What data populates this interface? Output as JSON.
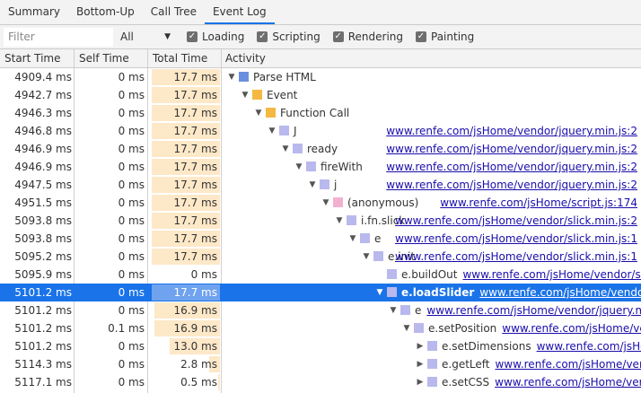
{
  "tabs": [
    "Summary",
    "Bottom-Up",
    "Call Tree",
    "Event Log"
  ],
  "selected_tab": "Event Log",
  "filter": {
    "placeholder": "Filter",
    "value": ""
  },
  "category_select": {
    "value": "All"
  },
  "checkboxes": [
    {
      "label": "Loading",
      "checked": true
    },
    {
      "label": "Scripting",
      "checked": true
    },
    {
      "label": "Rendering",
      "checked": true
    },
    {
      "label": "Painting",
      "checked": true
    }
  ],
  "columns": [
    "Start Time",
    "Self Time",
    "Total Time",
    "Activity"
  ],
  "colors": {
    "parse_html": "#6b8fe0",
    "event": "#f4b942",
    "script": "#b9b9ee",
    "anonymous": "#f3b1d0",
    "selection": "#1a73e8",
    "total_bar": "#fde8c8"
  },
  "rows": [
    {
      "start": "4909.4 ms",
      "self": "0 ms",
      "total": "17.7 ms",
      "total_frac": 1.0,
      "depth": 0,
      "arrow": "down",
      "color": "#6b8fe0",
      "name": "Parse HTML",
      "link": "",
      "link_align": "inline"
    },
    {
      "start": "4942.7 ms",
      "self": "0 ms",
      "total": "17.7 ms",
      "total_frac": 1.0,
      "depth": 1,
      "arrow": "down",
      "color": "#f4b942",
      "name": "Event",
      "link": "",
      "link_align": "inline"
    },
    {
      "start": "4946.3 ms",
      "self": "0 ms",
      "total": "17.7 ms",
      "total_frac": 1.0,
      "depth": 2,
      "arrow": "down",
      "color": "#f4b942",
      "name": "Function Call",
      "link": "",
      "link_align": "inline"
    },
    {
      "start": "4946.8 ms",
      "self": "0 ms",
      "total": "17.7 ms",
      "total_frac": 1.0,
      "depth": 3,
      "arrow": "down",
      "color": "#b9b9ee",
      "name": "J",
      "link": "www.renfe.com/jsHome/vendor/jquery.min.js:2",
      "link_align": "right"
    },
    {
      "start": "4946.9 ms",
      "self": "0 ms",
      "total": "17.7 ms",
      "total_frac": 1.0,
      "depth": 4,
      "arrow": "down",
      "color": "#b9b9ee",
      "name": "ready",
      "link": "www.renfe.com/jsHome/vendor/jquery.min.js:2",
      "link_align": "right"
    },
    {
      "start": "4946.9 ms",
      "self": "0 ms",
      "total": "17.7 ms",
      "total_frac": 1.0,
      "depth": 5,
      "arrow": "down",
      "color": "#b9b9ee",
      "name": "fireWith",
      "link": "www.renfe.com/jsHome/vendor/jquery.min.js:2",
      "link_align": "right"
    },
    {
      "start": "4947.5 ms",
      "self": "0 ms",
      "total": "17.7 ms",
      "total_frac": 1.0,
      "depth": 6,
      "arrow": "down",
      "color": "#b9b9ee",
      "name": "j",
      "link": "www.renfe.com/jsHome/vendor/jquery.min.js:2",
      "link_align": "right"
    },
    {
      "start": "4951.5 ms",
      "self": "0 ms",
      "total": "17.7 ms",
      "total_frac": 1.0,
      "depth": 7,
      "arrow": "down",
      "color": "#f3b1d0",
      "name": "(anonymous)",
      "link": "www.renfe.com/jsHome/script.js:174",
      "link_align": "right"
    },
    {
      "start": "5093.8 ms",
      "self": "0 ms",
      "total": "17.7 ms",
      "total_frac": 1.0,
      "depth": 8,
      "arrow": "down",
      "color": "#b9b9ee",
      "name": "i.fn.slick",
      "link": "www.renfe.com/jsHome/vendor/slick.min.js:2",
      "link_align": "right"
    },
    {
      "start": "5093.8 ms",
      "self": "0 ms",
      "total": "17.7 ms",
      "total_frac": 1.0,
      "depth": 9,
      "arrow": "down",
      "color": "#b9b9ee",
      "name": "e",
      "link": "www.renfe.com/jsHome/vendor/slick.min.js:1",
      "link_align": "right"
    },
    {
      "start": "5095.2 ms",
      "self": "0 ms",
      "total": "17.7 ms",
      "total_frac": 1.0,
      "depth": 10,
      "arrow": "down",
      "color": "#b9b9ee",
      "name": "e.init",
      "link": "www.renfe.com/jsHome/vendor/slick.min.js:1",
      "link_align": "right"
    },
    {
      "start": "5095.9 ms",
      "self": "0 ms",
      "total": "0 ms",
      "total_frac": 0.0,
      "depth": 11,
      "arrow": "",
      "color": "#b9b9ee",
      "name": "e.buildOut",
      "link": "www.renfe.com/jsHome/vendor/slic…",
      "link_align": "inline"
    },
    {
      "start": "5101.2 ms",
      "self": "0 ms",
      "total": "17.7 ms",
      "total_frac": 1.0,
      "depth": 11,
      "arrow": "down",
      "color": "#b9b9ee",
      "name": "e.loadSlider",
      "link": "www.renfe.com/jsHome/vendor/sl…",
      "link_align": "inline",
      "selected": true
    },
    {
      "start": "5101.2 ms",
      "self": "0 ms",
      "total": "16.9 ms",
      "total_frac": 0.955,
      "depth": 12,
      "arrow": "down",
      "color": "#b9b9ee",
      "name": "e",
      "link": "www.renfe.com/jsHome/vendor/jquery.mi…",
      "link_align": "inline"
    },
    {
      "start": "5101.2 ms",
      "self": "0.1 ms",
      "total": "16.9 ms",
      "total_frac": 0.955,
      "depth": 13,
      "arrow": "down",
      "color": "#b9b9ee",
      "name": "e.setPosition",
      "link": "www.renfe.com/jsHome/ve…",
      "link_align": "inline"
    },
    {
      "start": "5101.2 ms",
      "self": "0 ms",
      "total": "13.0 ms",
      "total_frac": 0.734,
      "depth": 14,
      "arrow": "right",
      "color": "#b9b9ee",
      "name": "e.setDimensions",
      "link": "www.renfe.com/jsHo…",
      "link_align": "inline"
    },
    {
      "start": "5114.3 ms",
      "self": "0 ms",
      "total": "2.8 ms",
      "total_frac": 0.158,
      "depth": 14,
      "arrow": "right",
      "color": "#b9b9ee",
      "name": "e.getLeft",
      "link": "www.renfe.com/jsHome/ven…",
      "link_align": "inline"
    },
    {
      "start": "5117.1 ms",
      "self": "0 ms",
      "total": "0.5 ms",
      "total_frac": 0.028,
      "depth": 14,
      "arrow": "right",
      "color": "#b9b9ee",
      "name": "e.setCSS",
      "link": "www.renfe.com/jsHome/ven…",
      "link_align": "inline"
    }
  ]
}
